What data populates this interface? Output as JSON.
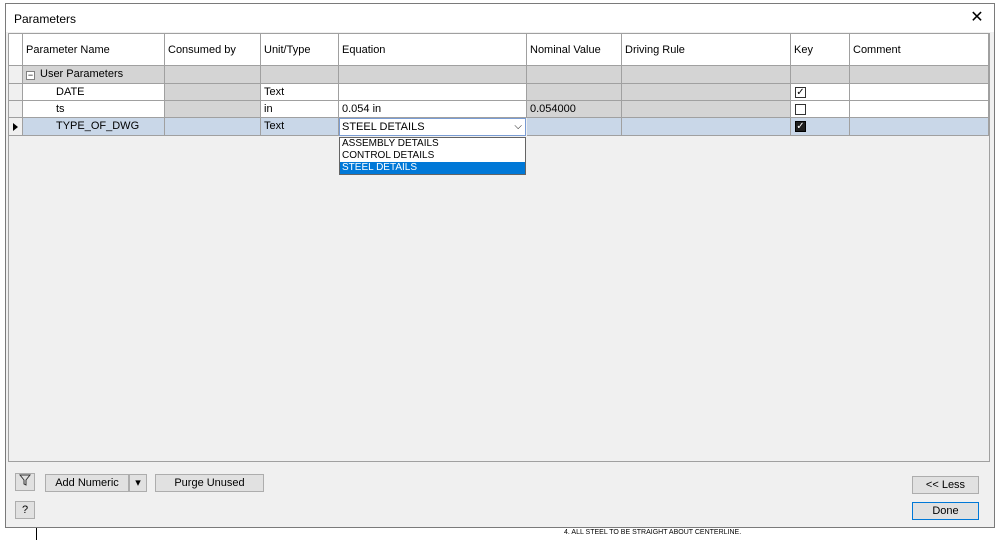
{
  "dialog": {
    "title": "Parameters"
  },
  "columns": [
    "Parameter Name",
    "Consumed by",
    "Unit/Type",
    "Equation",
    "Nominal Value",
    "Driving Rule",
    "Key",
    "Comment"
  ],
  "group": {
    "label": "User Parameters",
    "expander": "−"
  },
  "rows": [
    {
      "name": "DATE",
      "unit": "Text",
      "equation": "",
      "nominal": "",
      "key_checked": true
    },
    {
      "name": "ts",
      "unit": "in",
      "equation": "0.054 in",
      "nominal": "0.054000",
      "key_checked": false
    },
    {
      "name": "TYPE_OF_DWG",
      "unit": "Text",
      "equation": "STEEL DETAILS",
      "nominal": "",
      "key_checked": true
    }
  ],
  "dropdown": {
    "options": [
      "ASSEMBLY DETAILS",
      "CONTROL DETAILS",
      "STEEL DETAILS"
    ],
    "selected": "STEEL DETAILS"
  },
  "buttons": {
    "add_numeric": "Add Numeric",
    "purge_unused": "Purge Unused",
    "less": "<< Less",
    "done": "Done"
  },
  "icons": {
    "filter": "filter-icon",
    "help": "help-icon",
    "close": "close-icon",
    "chevron": "chevron-down-icon",
    "dropdown_arrow": "triangle-down-icon"
  },
  "background_note": "4. ALL STEEL TO BE STRAIGHT ABOUT CENTERLINE.",
  "colors": {
    "selected_row": "#c9d7e8",
    "highlight": "#0078d7",
    "readonly_cell": "#d4d4d4"
  }
}
